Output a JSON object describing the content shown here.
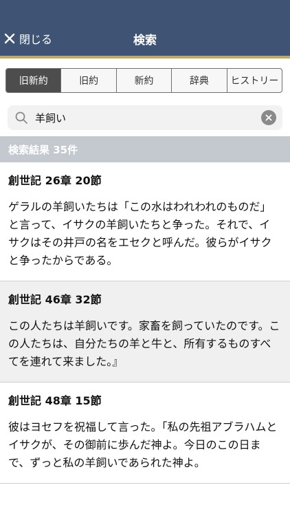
{
  "navbar": {
    "close_label": "閉じる",
    "title": "検索"
  },
  "segments": [
    {
      "label": "旧新約",
      "active": true
    },
    {
      "label": "旧約",
      "active": false
    },
    {
      "label": "新約",
      "active": false
    },
    {
      "label": "辞典",
      "active": false
    },
    {
      "label": "ヒストリー",
      "active": false
    }
  ],
  "search": {
    "value": "羊飼い",
    "placeholder": "",
    "icon": "search-icon"
  },
  "results_header": "検索結果 35件",
  "results": [
    {
      "reference": "創世記 26章 20節",
      "text": "ゲラルの羊飼いたちは「この水はわれわれのものだ」と言って、イサクの羊飼いたちと争った。それで、イサクはその井戸の名をエセクと呼んだ。彼らがイサクと争ったからである。"
    },
    {
      "reference": "創世記 46章 32節",
      "text": "この人たちは羊飼いです。家畜を飼っていたのです。この人たちは、自分たちの羊と牛と、所有するものすべてを連れて来ました。』"
    },
    {
      "reference": "創世記 48章 15節",
      "text": "彼はヨセフを祝福して言った。「私の先祖アブラハムとイサクが、その御前に歩んだ神よ。今日のこの日まで、ずっと私の羊飼いであられた神よ。"
    }
  ],
  "colors": {
    "navbar": "#3f5474",
    "navbar_accent": "#c6a85c",
    "results_header": "#c4c8cf",
    "segment_active": "#4d4d4d"
  }
}
